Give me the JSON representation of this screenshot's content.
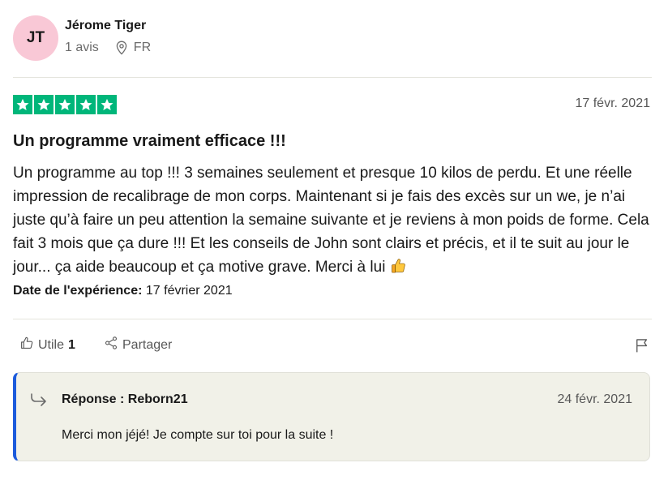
{
  "reviewer": {
    "initials": "JT",
    "name": "Jérome Tiger",
    "reviews_count": "1 avis",
    "country": "FR",
    "avatar_color": "#f9c8d6",
    "location_icon": "location-pin-icon"
  },
  "review": {
    "rating": 5,
    "rating_max": 5,
    "star_color": "#00b67a",
    "date": "17 févr. 2021",
    "title": "Un programme vraiment efficace !!!",
    "body": "Un programme au top !!! 3 semaines seulement et presque 10 kilos de perdu. Et une réelle impression de recalibrage de mon corps. Maintenant si je fais des excès sur un we, je n’ai juste qu’à faire un peu attention la semaine suivante et je reviens à mon poids de forme. Cela fait 3 mois que ça dure !!! Et les conseils de John sont clairs et précis, et il te suit au jour le jour... ça aide beaucoup et ça motive grave. Merci à lui",
    "body_emoji_icon": "thumbs-up-emoji-icon",
    "experience_label": "Date de l'expérience:",
    "experience_date": "17 février 2021"
  },
  "actions": {
    "useful_label": "Utile",
    "useful_count": "1",
    "share_label": "Partager",
    "flag_icon": "flag-icon"
  },
  "reply": {
    "label": "Réponse : Reborn21",
    "date": "24 févr. 2021",
    "text": "Merci mon jéjé! Je compte sur toi pour la suite !",
    "accent_color": "#1c5bdc"
  }
}
